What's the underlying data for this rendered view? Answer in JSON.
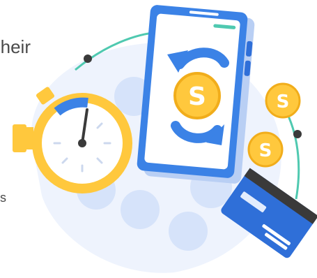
{
  "text_fragments": {
    "top_right": "heir",
    "side": "s"
  },
  "coins": {
    "symbol": "S"
  },
  "colors": {
    "accent_blue": "#3b82e6",
    "dark_blue": "#2f6fd8",
    "light_blue": "#cfe0fb",
    "yellow": "#ffc83d",
    "dark_yellow": "#f1ad1b",
    "teal": "#4fc9b0",
    "ink": "#4a4a4a"
  },
  "icons": [
    "stopwatch-icon",
    "smartphone-icon",
    "refresh-arrows-icon",
    "coin-icon",
    "credit-card-icon"
  ]
}
